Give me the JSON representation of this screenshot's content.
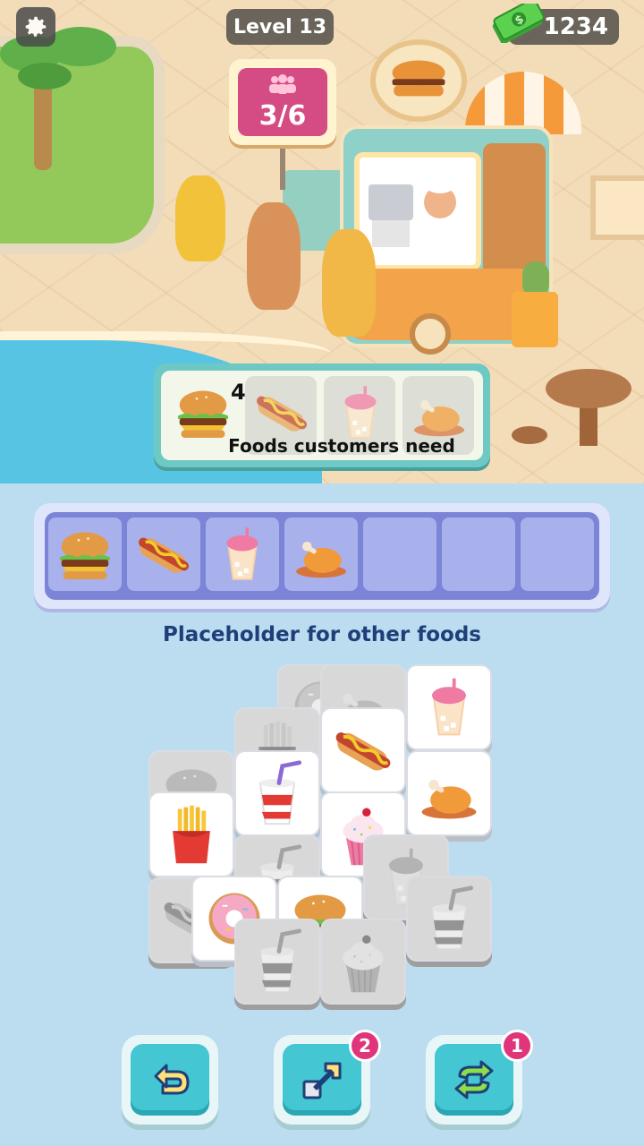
{
  "hud": {
    "level": "Level 13",
    "cash": "1234",
    "settings_icon": "gear-icon",
    "cash_icon": "cash-stack-icon"
  },
  "queue_sign": {
    "count": "3/6",
    "icon": "people-icon"
  },
  "customer_needs": {
    "label": "Foods customers need",
    "current_count": "4",
    "items": [
      "burger",
      "hotdog",
      "bubble-tea",
      "roast-chicken"
    ]
  },
  "holding_bar": {
    "label": "Placeholder for other foods",
    "slots": [
      "burger",
      "hotdog",
      "bubble-tea",
      "roast-chicken",
      "",
      "",
      ""
    ]
  },
  "board": {
    "tiles": [
      {
        "food": "donut",
        "locked": true
      },
      {
        "food": "roast-chicken",
        "locked": true
      },
      {
        "food": "bubble-tea",
        "locked": false
      },
      {
        "food": "fries",
        "locked": true
      },
      {
        "food": "hotdog",
        "locked": false
      },
      {
        "food": "burger",
        "locked": true
      },
      {
        "food": "soda",
        "locked": false
      },
      {
        "food": "roast-chicken",
        "locked": false
      },
      {
        "food": "fries",
        "locked": false
      },
      {
        "food": "cupcake",
        "locked": false
      },
      {
        "food": "soda",
        "locked": true
      },
      {
        "food": "bubble-tea",
        "locked": true
      },
      {
        "food": "hotdog",
        "locked": true
      },
      {
        "food": "donut",
        "locked": false
      },
      {
        "food": "burger",
        "locked": false
      },
      {
        "food": "soda",
        "locked": true
      },
      {
        "food": "soda",
        "locked": true
      },
      {
        "food": "cupcake",
        "locked": true
      }
    ]
  },
  "tools": [
    {
      "name": "undo",
      "icon": "undo-arrow-icon",
      "badge": ""
    },
    {
      "name": "move-out",
      "icon": "move-out-arrow-icon",
      "badge": "2"
    },
    {
      "name": "shuffle",
      "icon": "shuffle-arrows-icon",
      "badge": "1"
    }
  ],
  "colors": {
    "accent_teal": "#45c6d3",
    "badge_pink": "#e0357a",
    "slot_bar_purple": "#7b84d6",
    "label_navy": "#1f3f7a"
  }
}
